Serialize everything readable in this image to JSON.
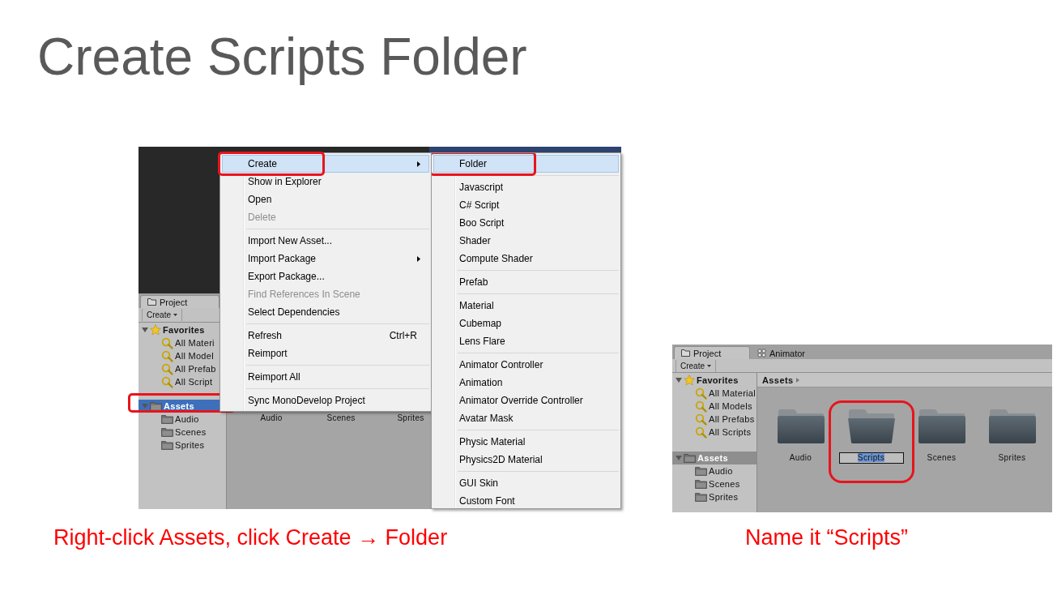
{
  "title": "Create Scripts Folder",
  "left_screenshot": {
    "project_tab": {
      "label": "Project",
      "selected": true
    },
    "create_button": "Create",
    "tree": [
      {
        "label": "Favorites",
        "kind": "favorites",
        "expanded": true,
        "selected": false,
        "callout": false,
        "children": [
          {
            "label": "All Materi",
            "kind": "search"
          },
          {
            "label": "All Model",
            "kind": "search"
          },
          {
            "label": "All Prefab",
            "kind": "search"
          },
          {
            "label": "All Script",
            "kind": "search"
          }
        ]
      },
      {
        "label": "Assets",
        "kind": "folder",
        "expanded": true,
        "selected": true,
        "callout": true,
        "children": [
          {
            "label": "Audio",
            "kind": "folder"
          },
          {
            "label": "Scenes",
            "kind": "folder"
          },
          {
            "label": "Sprites",
            "kind": "folder"
          }
        ]
      }
    ],
    "grid_labels": [
      "Audio",
      "Scenes",
      "Sprites"
    ],
    "context_menu": {
      "groups": [
        [
          {
            "label": "Create",
            "highlighted": true,
            "disabled": false,
            "submenu": true,
            "callout": true
          },
          {
            "label": "Show in Explorer",
            "highlighted": false,
            "disabled": false,
            "submenu": false,
            "callout": false
          },
          {
            "label": "Open",
            "highlighted": false,
            "disabled": false,
            "submenu": false,
            "callout": false
          },
          {
            "label": "Delete",
            "highlighted": false,
            "disabled": true,
            "submenu": false,
            "callout": false
          }
        ],
        [
          {
            "label": "Import New Asset...",
            "highlighted": false,
            "disabled": false,
            "submenu": false,
            "callout": false
          },
          {
            "label": "Import Package",
            "highlighted": false,
            "disabled": false,
            "submenu": true,
            "callout": false
          },
          {
            "label": "Export Package...",
            "highlighted": false,
            "disabled": false,
            "submenu": false,
            "callout": false
          },
          {
            "label": "Find References In Scene",
            "highlighted": false,
            "disabled": true,
            "submenu": false,
            "callout": false
          },
          {
            "label": "Select Dependencies",
            "highlighted": false,
            "disabled": false,
            "submenu": false,
            "callout": false
          }
        ],
        [
          {
            "label": "Refresh",
            "shortcut": "Ctrl+R",
            "highlighted": false,
            "disabled": false,
            "submenu": false,
            "callout": false
          },
          {
            "label": "Reimport",
            "highlighted": false,
            "disabled": false,
            "submenu": false,
            "callout": false
          }
        ],
        [
          {
            "label": "Reimport All",
            "highlighted": false,
            "disabled": false,
            "submenu": false,
            "callout": false
          }
        ],
        [
          {
            "label": "Sync MonoDevelop Project",
            "highlighted": false,
            "disabled": false,
            "submenu": false,
            "callout": false
          }
        ]
      ]
    },
    "submenu": {
      "groups": [
        [
          {
            "label": "Folder",
            "highlighted": true,
            "disabled": false,
            "submenu": false,
            "callout": true
          }
        ],
        [
          {
            "label": "Javascript",
            "highlighted": false,
            "disabled": false,
            "submenu": false,
            "callout": false
          },
          {
            "label": "C# Script",
            "highlighted": false,
            "disabled": false,
            "submenu": false,
            "callout": false
          },
          {
            "label": "Boo Script",
            "highlighted": false,
            "disabled": false,
            "submenu": false,
            "callout": false
          },
          {
            "label": "Shader",
            "highlighted": false,
            "disabled": false,
            "submenu": false,
            "callout": false
          },
          {
            "label": "Compute Shader",
            "highlighted": false,
            "disabled": false,
            "submenu": false,
            "callout": false
          }
        ],
        [
          {
            "label": "Prefab",
            "highlighted": false,
            "disabled": false,
            "submenu": false,
            "callout": false
          }
        ],
        [
          {
            "label": "Material",
            "highlighted": false,
            "disabled": false,
            "submenu": false,
            "callout": false
          },
          {
            "label": "Cubemap",
            "highlighted": false,
            "disabled": false,
            "submenu": false,
            "callout": false
          },
          {
            "label": "Lens Flare",
            "highlighted": false,
            "disabled": false,
            "submenu": false,
            "callout": false
          }
        ],
        [
          {
            "label": "Animator Controller",
            "highlighted": false,
            "disabled": false,
            "submenu": false,
            "callout": false
          },
          {
            "label": "Animation",
            "highlighted": false,
            "disabled": false,
            "submenu": false,
            "callout": false
          },
          {
            "label": "Animator Override Controller",
            "highlighted": false,
            "disabled": false,
            "submenu": false,
            "callout": false
          },
          {
            "label": "Avatar Mask",
            "highlighted": false,
            "disabled": false,
            "submenu": false,
            "callout": false
          }
        ],
        [
          {
            "label": "Physic Material",
            "highlighted": false,
            "disabled": false,
            "submenu": false,
            "callout": false
          },
          {
            "label": "Physics2D Material",
            "highlighted": false,
            "disabled": false,
            "submenu": false,
            "callout": false
          }
        ],
        [
          {
            "label": "GUI Skin",
            "highlighted": false,
            "disabled": false,
            "submenu": false,
            "callout": false
          },
          {
            "label": "Custom Font",
            "highlighted": false,
            "disabled": false,
            "submenu": false,
            "callout": false
          }
        ]
      ]
    }
  },
  "left_caption": "Right-click Assets, click Create → Folder",
  "right_screenshot": {
    "tabs": [
      {
        "label": "Project",
        "kind": "project",
        "selected": true
      },
      {
        "label": "Animator",
        "kind": "animator",
        "selected": false
      }
    ],
    "create_button": "Create",
    "tree": [
      {
        "label": "Favorites",
        "kind": "favorites",
        "expanded": true,
        "selected": false,
        "callout": false,
        "children": [
          {
            "label": "All Material",
            "kind": "search"
          },
          {
            "label": "All Models",
            "kind": "search"
          },
          {
            "label": "All Prefabs",
            "kind": "search"
          },
          {
            "label": "All Scripts",
            "kind": "search"
          }
        ]
      },
      {
        "label": "Assets",
        "kind": "folder",
        "expanded": true,
        "selected": true,
        "callout": false,
        "children": [
          {
            "label": "Audio",
            "kind": "folder"
          },
          {
            "label": "Scenes",
            "kind": "folder"
          },
          {
            "label": "Sprites",
            "kind": "folder"
          }
        ]
      }
    ],
    "breadcrumb": "Assets",
    "items": [
      {
        "label": "Audio",
        "renaming": false,
        "callout": false
      },
      {
        "label": "Scripts",
        "renaming": true,
        "callout": true
      },
      {
        "label": "Scenes",
        "renaming": false,
        "callout": false
      },
      {
        "label": "Sprites",
        "renaming": false,
        "callout": false
      }
    ]
  },
  "right_caption": "Name it “Scripts”"
}
